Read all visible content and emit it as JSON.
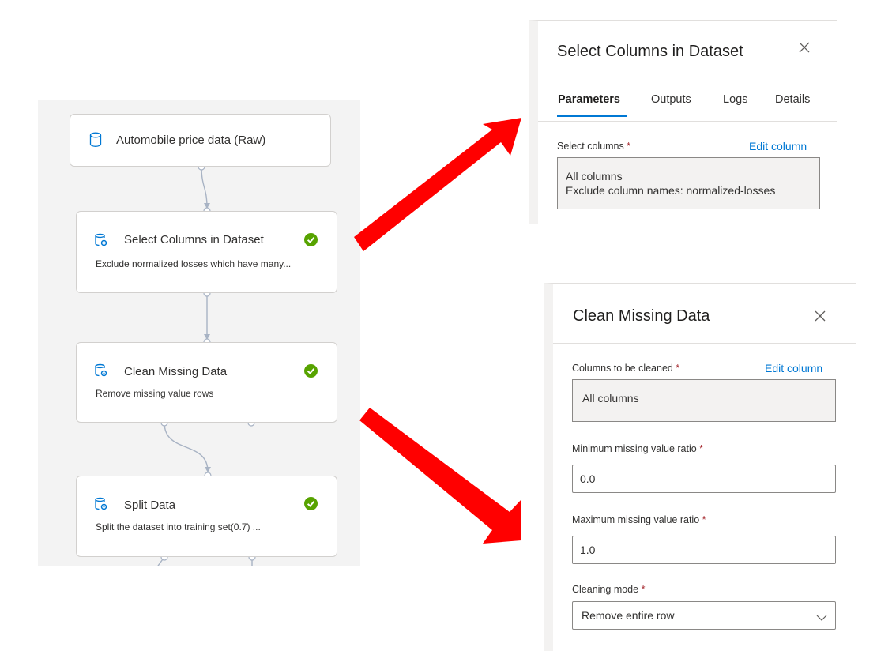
{
  "pipeline": {
    "nodes": [
      {
        "title": "Automobile price data (Raw)",
        "icon": "database-icon"
      },
      {
        "title": "Select Columns in Dataset",
        "description": "Exclude normalized losses which have many...",
        "icon": "module-icon",
        "status": "completed"
      },
      {
        "title": "Clean Missing Data",
        "description": "Remove missing value rows",
        "icon": "module-icon",
        "status": "completed"
      },
      {
        "title": "Split Data",
        "description": "Split the dataset into training set(0.7) ...",
        "icon": "module-icon",
        "status": "completed"
      }
    ]
  },
  "select_columns_panel": {
    "title": "Select Columns in Dataset",
    "close_icon": "close-icon",
    "tabs": [
      "Parameters",
      "Outputs",
      "Logs",
      "Details"
    ],
    "active_tab": "Parameters",
    "field_label": "Select columns",
    "required_mark": "*",
    "edit_link": "Edit column",
    "value_line1": "All columns",
    "value_line2": "Exclude column names: normalized-losses"
  },
  "clean_missing_panel": {
    "title": "Clean Missing Data",
    "close_icon": "close-icon",
    "columns_label": "Columns to be cleaned",
    "required_mark": "*",
    "edit_link": "Edit column",
    "columns_value": "All columns",
    "min_label": "Minimum missing value ratio",
    "min_value": "0.0",
    "max_label": "Maximum missing value ratio",
    "max_value": "1.0",
    "mode_label": "Cleaning mode",
    "mode_value": "Remove entire row"
  },
  "colors": {
    "accent": "#0078d4",
    "success": "#57a300",
    "arrow": "#ff0000",
    "canvas_bg": "#f3f3f3"
  }
}
